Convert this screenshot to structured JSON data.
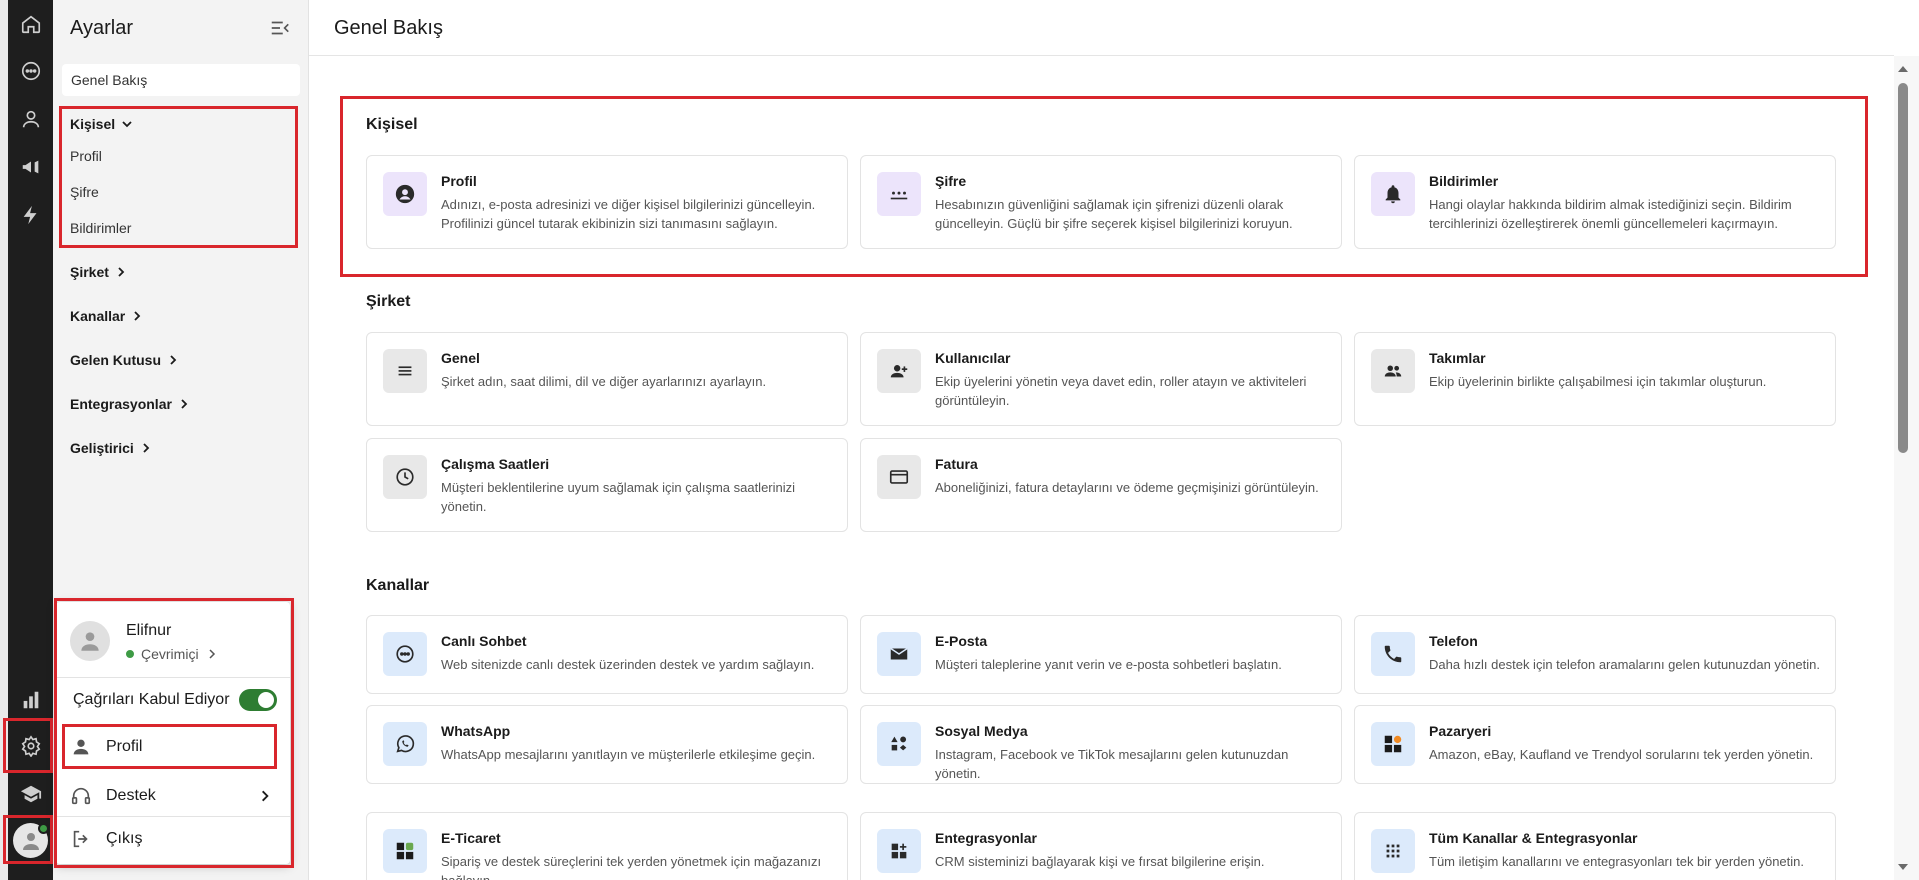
{
  "sidebar": {
    "title": "Ayarlar",
    "overview": "Genel Bakış",
    "groups": [
      {
        "label": "Kişisel",
        "children": [
          "Profil",
          "Şifre",
          "Bildirimler"
        ]
      },
      {
        "label": "Şirket"
      },
      {
        "label": "Kanallar"
      },
      {
        "label": "Gelen Kutusu"
      },
      {
        "label": "Entegrasyonlar"
      },
      {
        "label": "Geliştirici"
      }
    ]
  },
  "main": {
    "title": "Genel Bakış",
    "sections": [
      {
        "title": "Kişisel",
        "cards": [
          {
            "title": "Profil",
            "desc": "Adınızı, e-posta adresinizi ve diğer kişisel bilgilerinizi güncelleyin. Profilinizi güncel tutarak ekibinizin sizi tanımasını sağlayın.",
            "icon": "account-circle-icon"
          },
          {
            "title": "Şifre",
            "desc": "Hesabınızın güvenliğini sağlamak için şifrenizi düzenli olarak güncelleyin. Güçlü bir şifre seçerek kişisel bilgilerinizi koruyun.",
            "icon": "password-icon"
          },
          {
            "title": "Bildirimler",
            "desc": "Hangi olaylar hakkında bildirim almak istediğinizi seçin. Bildirim tercihlerinizi özelleştirerek önemli güncellemeleri kaçırmayın.",
            "icon": "bell-icon"
          }
        ]
      },
      {
        "title": "Şirket",
        "cards": [
          {
            "title": "Genel",
            "desc": "Şirket adın, saat dilimi, dil ve diğer ayarlarınızı ayarlayın.",
            "icon": "menu-lines-icon"
          },
          {
            "title": "Kullanıcılar",
            "desc": "Ekip üyelerini yönetin veya davet edin, roller atayın ve aktiviteleri görüntüleyin.",
            "icon": "person-add-icon"
          },
          {
            "title": "Takımlar",
            "desc": "Ekip üyelerinin birlikte çalışabilmesi için takımlar oluşturun.",
            "icon": "group-icon"
          },
          {
            "title": "Çalışma Saatleri",
            "desc": "Müşteri beklentilerine uyum sağlamak için çalışma saatlerinizi yönetin.",
            "icon": "clock-icon"
          },
          {
            "title": "Fatura",
            "desc": "Aboneliğinizi, fatura detaylarını ve ödeme geçmişinizi görüntüleyin.",
            "icon": "credit-card-icon"
          }
        ]
      },
      {
        "title": "Kanallar",
        "cards": [
          {
            "title": "Canlı Sohbet",
            "desc": "Web sitenizde canlı destek üzerinden destek ve yardım sağlayın.",
            "icon": "chat-bubble-icon"
          },
          {
            "title": "E-Posta",
            "desc": "Müşteri taleplerine yanıt verin ve e-posta sohbetleri başlatın.",
            "icon": "mail-icon"
          },
          {
            "title": "Telefon",
            "desc": "Daha hızlı destek için telefon aramalarını gelen kutunuzdan yönetin.",
            "icon": "phone-icon"
          },
          {
            "title": "WhatsApp",
            "desc": "WhatsApp mesajlarını yanıtlayın ve müşterilerle etkileşime geçin.",
            "icon": "whatsapp-icon"
          },
          {
            "title": "Sosyal Medya",
            "desc": "Instagram, Facebook ve TikTok mesajlarını gelen kutunuzdan yönetin.",
            "icon": "shapes-icon"
          },
          {
            "title": "Pazaryeri",
            "desc": "Amazon, eBay, Kaufland ve Trendyol sorularını tek yerden yönetin.",
            "icon": "marketplace-icon"
          },
          {
            "title": "E-Ticaret",
            "desc": "Sipariş ve destek süreçlerini tek yerden yönetmek için mağazanızı bağlayın.",
            "icon": "ecommerce-icon"
          },
          {
            "title": "Entegrasyonlar",
            "desc": "CRM sisteminizi bağlayarak kişi ve fırsat bilgilerine erişin.",
            "icon": "widgets-add-icon"
          },
          {
            "title": "Tüm Kanallar & Entegrasyonlar",
            "desc": "Tüm iletişim kanallarını ve entegrasyonları tek bir yerden yönetin.",
            "icon": "apps-grid-icon"
          }
        ]
      }
    ]
  },
  "popup": {
    "user_name": "Elifnur",
    "status": "Çevrimiçi",
    "accept_calls_label": "Çağrıları Kabul Ediyor",
    "accept_calls_on": true,
    "items": [
      "Profil",
      "Destek",
      "Çıkış"
    ]
  },
  "colors": {
    "rail_bg": "#1e1e1e",
    "highlight_red": "#d9262c",
    "online_green": "#3e9b45",
    "toggle_green": "#2e7d32"
  }
}
